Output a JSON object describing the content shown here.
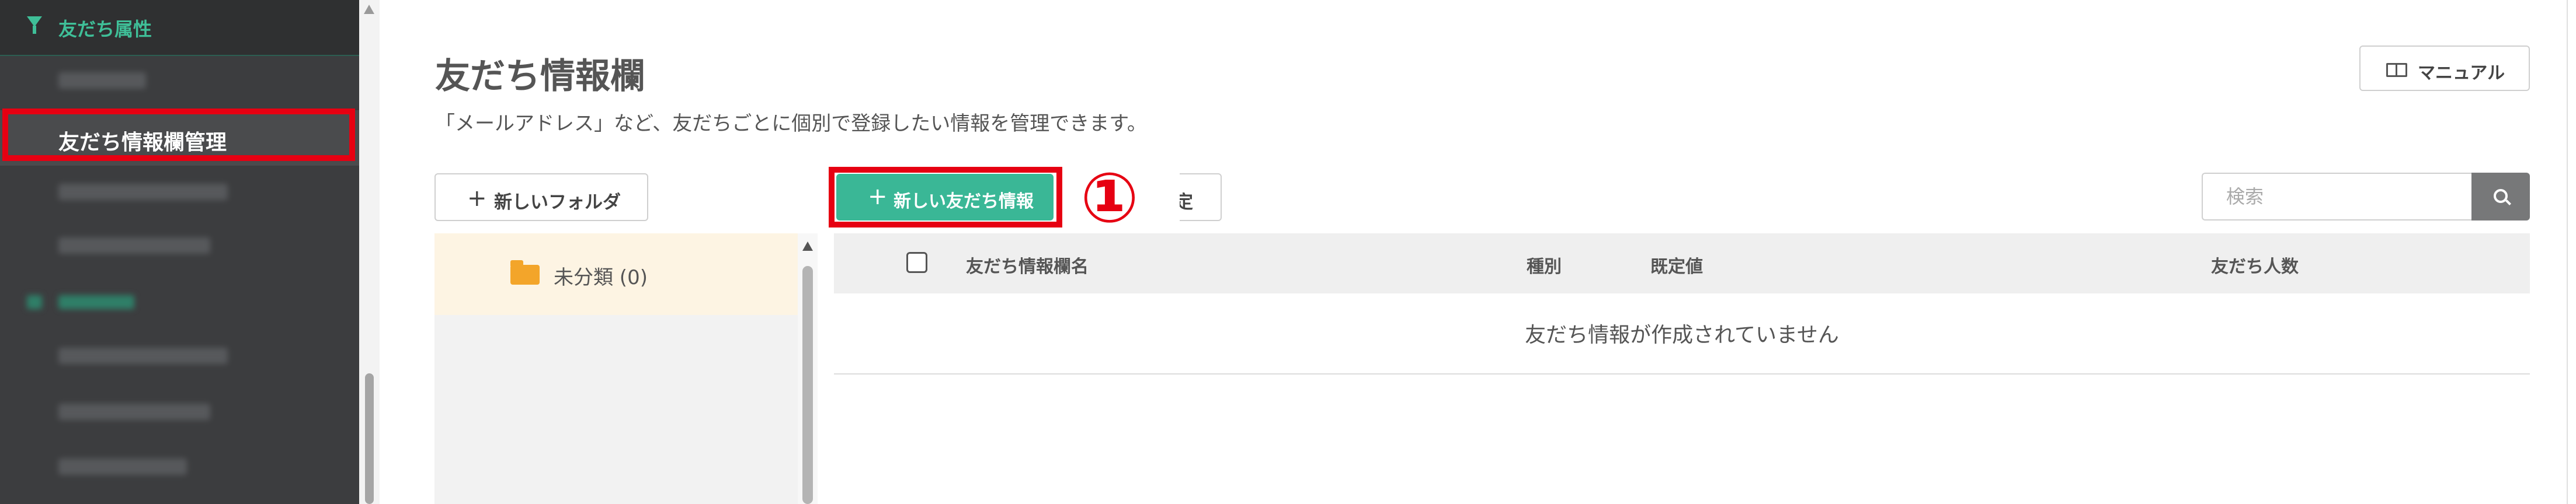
{
  "sidebar": {
    "section_label": "友だち属性",
    "active_item": "友だち情報欄管理"
  },
  "header": {
    "title": "友だち情報欄",
    "description": "「メールアドレス」など、友だちごとに個別で登録したい情報を管理できます。",
    "manual_button": "マニュアル"
  },
  "toolbar": {
    "new_folder_button": "新しいフォルダ",
    "new_info_button": "新しい友だち情報",
    "settings_button_partial": "定",
    "annotation_number": "①",
    "search_placeholder": "検索"
  },
  "folders": {
    "items": [
      {
        "label": "未分類 (0)"
      }
    ]
  },
  "table": {
    "columns": [
      "友だち情報欄名",
      "種別",
      "既定値",
      "友だち人数"
    ],
    "empty_message": "友だち情報が作成されていません"
  },
  "colors": {
    "sidebar_bg": "#3c3d3f",
    "accent_green": "#3ab796",
    "highlight_red": "#e60012",
    "folder_orange": "#f3a52a"
  },
  "icons": [
    "funnel-icon",
    "book-icon",
    "plus-icon",
    "folder-icon",
    "search-icon"
  ]
}
